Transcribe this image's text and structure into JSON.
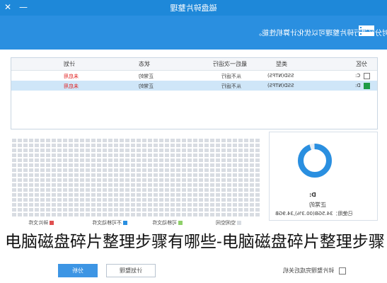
{
  "window": {
    "title": "磁盘碎片整理",
    "min_icon": "minimize-icon",
    "close_icon": "close-icon"
  },
  "header": {
    "subtitle": "对分区进行碎片整理可以优化计算机性能。",
    "logo_icon": "disk-tool-icon"
  },
  "table": {
    "columns": [
      "分区",
      "类型",
      "最后一次运行",
      "状态",
      "计划"
    ],
    "rows": [
      {
        "drive": "C:",
        "type": "SSD(NTFS)",
        "last_run": "从不运行",
        "status": "正常的",
        "plan": "未启用",
        "checked": false,
        "selected": false
      },
      {
        "drive": "D:",
        "type": "SSD(NTFS)",
        "last_run": "从不运行",
        "status": "正常的",
        "plan": "未启用",
        "checked": true,
        "selected": true
      }
    ]
  },
  "drive_info": {
    "drive_label": "D:",
    "status": "正常的",
    "used_text": "已使用：34.5GB(00.3%),34.9GB",
    "ring_color": "#2a8fe0"
  },
  "legend": {
    "items": [
      {
        "label": "空闲空间",
        "color": "#d8dce2"
      },
      {
        "label": "可移动文件",
        "color": "#8fd06a"
      },
      {
        "label": "不可移动文件",
        "color": "#2a8fe0"
      },
      {
        "label": "碎片文件",
        "color": "#e05050"
      }
    ]
  },
  "caption": {
    "text": "电脑磁盘碎片整理步骤有哪些-电脑磁盘碎片整理步骤"
  },
  "footer": {
    "analyze_button": "分析",
    "plan_button": "计划整理",
    "shutdown_label": "碎片整理完成后关机"
  }
}
